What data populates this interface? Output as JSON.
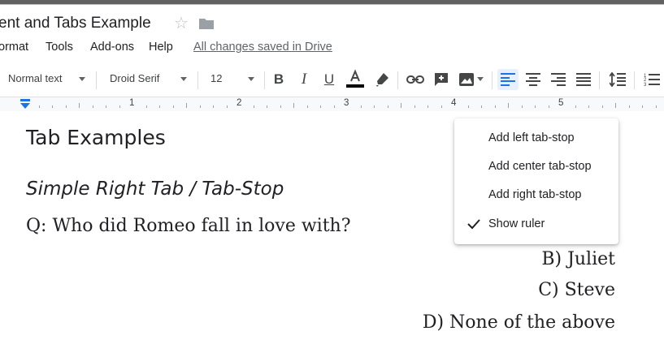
{
  "document": {
    "title": "ent and Tabs Example",
    "save_status": "All changes saved in Drive"
  },
  "menu": {
    "items": [
      "ormat",
      "Tools",
      "Add-ons",
      "Help"
    ]
  },
  "toolbar": {
    "style": "Normal text",
    "font": "Droid Serif",
    "size": "12",
    "active_align": "left",
    "text_color": "#000000"
  },
  "ruler": {
    "numbers": [
      "1",
      "2",
      "3",
      "4",
      "5"
    ]
  },
  "content": {
    "heading1": "Tab Examples",
    "heading2": "Simple Right Tab / Tab-Stop",
    "question": "Q: Who did Romeo fall in love with?",
    "answers": [
      "B) Juliet",
      "C) Steve",
      "D) None of the above"
    ]
  },
  "context_menu": {
    "items": [
      {
        "label": "Add left tab-stop",
        "checked": false
      },
      {
        "label": "Add center tab-stop",
        "checked": false
      },
      {
        "label": "Add right tab-stop",
        "checked": false
      },
      {
        "label": "Show ruler",
        "checked": true
      }
    ]
  },
  "colors": {
    "accent": "#1a73e8",
    "active_bg": "#e8f0fe",
    "icon": "#444746"
  }
}
